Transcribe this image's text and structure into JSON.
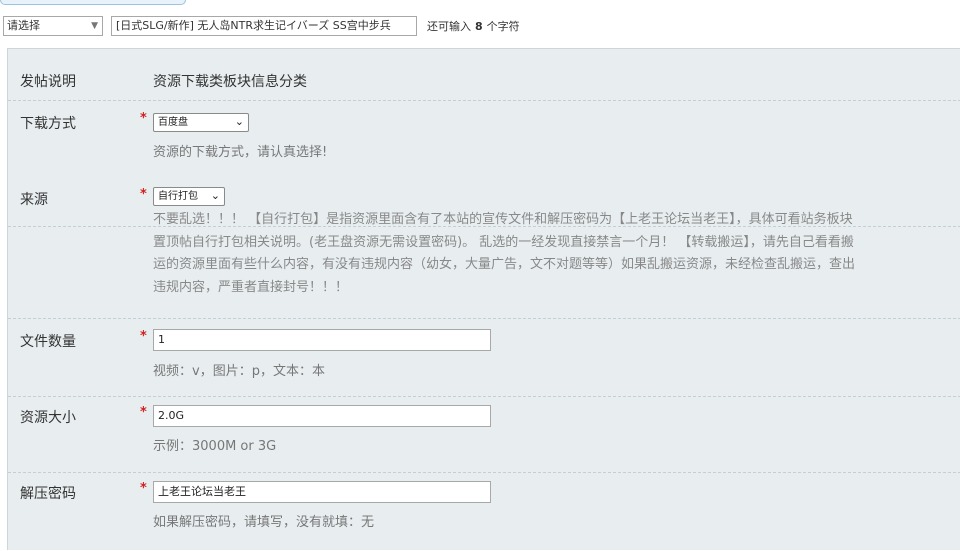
{
  "title_row": {
    "type_select_value": "请选择",
    "title_value": "[日式SLG/新作] 无人岛NTR求生记イバーズ SS宫中步兵",
    "char_hint_prefix": "还可输入",
    "char_hint_count": "8",
    "char_hint_suffix": "个字符"
  },
  "form": {
    "posting_note": {
      "label": "发帖说明",
      "value": "资源下载类板块信息分类"
    },
    "download_method": {
      "label": "下载方式",
      "required": "*",
      "selected": "百度盘",
      "hint": "资源的下载方式，请认真选择!"
    },
    "source": {
      "label": "来源",
      "required": "*",
      "selected": "自行打包",
      "hint_lines": [
        "不要乱选！！！ 【自行打包】是指资源里面含有了本站的宣传文件和解压密码为【上老王论坛当老王】，具体可看站务板块",
        "置顶帖自行打包相关说明。(老王盘资源无需设置密码)。 乱选的一经发现直接禁言一个月！ 【转载搬运】，请先自己看看搬",
        "运的资源里面有些什么内容，有没有违规内容（幼女，大量广告，文不对题等等）如果乱搬运资源，未经检查乱搬运，查出",
        "违规内容，严重者直接封号！！！"
      ]
    },
    "file_count": {
      "label": "文件数量",
      "required": "*",
      "value": "1",
      "hint": "视频：v，图片：p，文本：本"
    },
    "resource_size": {
      "label": "资源大小",
      "required": "*",
      "value": "2.0G",
      "hint": "示例：3000M or 3G"
    },
    "unzip_password": {
      "label": "解压密码",
      "required": "*",
      "value": "上老王论坛当老王",
      "hint": "如果解压密码，请填写，没有就填：无"
    }
  }
}
